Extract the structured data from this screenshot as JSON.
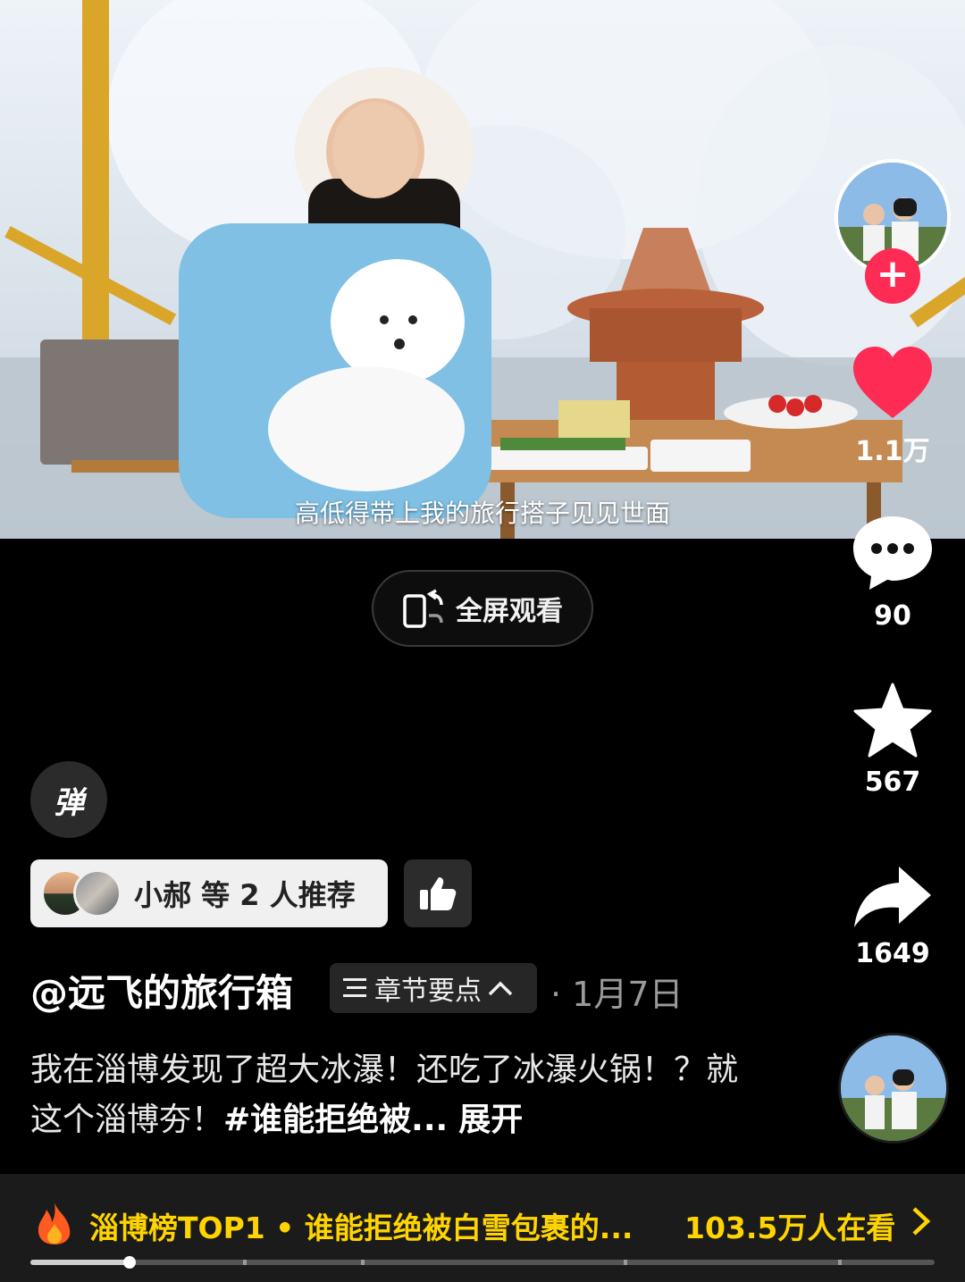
{
  "video": {
    "subtitle": "高低得带上我的旅行搭子见见世面"
  },
  "sidebar": {
    "avatar_icon": "creator-avatar-icon",
    "follow_symbol": "+",
    "like_count": "1.1万",
    "comment_count": "90",
    "favorite_count": "567",
    "share_count": "1649"
  },
  "fullscreen": {
    "label": "全屏观看"
  },
  "danmaku": {
    "label": "弹"
  },
  "recommend": {
    "text": "小郝 等 2 人推荐"
  },
  "author": {
    "name": "@远飞的旅行箱",
    "chapters_label": "章节要点",
    "date": "· 1月7日"
  },
  "description": {
    "text": "我在淄博发现了超大冰瀑！还吃了冰瀑火锅！？就这个淄博夯！",
    "hashtag": "#谁能拒绝被...",
    "more": "展开"
  },
  "hotbar": {
    "rank_text": "淄博榜TOP1 • 谁能拒绝被白雪包裹的...",
    "viewers": "103.5万人在看"
  },
  "playback": {
    "progress_fraction": 0.11
  },
  "colors": {
    "like_red": "#fe2c55",
    "hot_yellow": "#ffd400",
    "background": "#000000"
  }
}
